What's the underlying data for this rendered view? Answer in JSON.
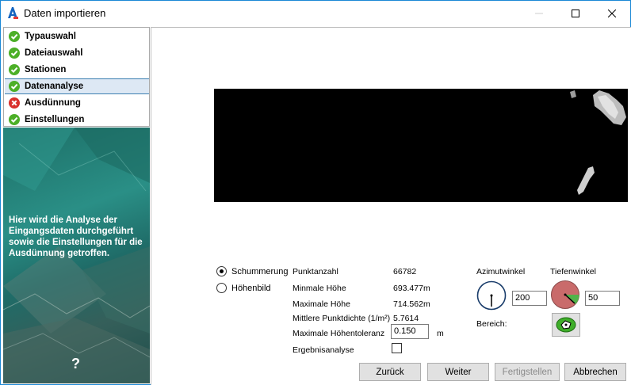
{
  "window": {
    "title": "Daten importieren"
  },
  "steps": [
    {
      "label": "Typauswahl",
      "status": "ok"
    },
    {
      "label": "Dateiauswahl",
      "status": "ok"
    },
    {
      "label": "Stationen",
      "status": "ok"
    },
    {
      "label": "Datenanalyse",
      "status": "ok"
    },
    {
      "label": "Ausdünnung",
      "status": "error"
    },
    {
      "label": "Einstellungen",
      "status": "ok"
    }
  ],
  "info_panel": {
    "text": "Hier wird die Analyse der Eingangsdaten durchgeführt sowie die Einstellungen für die Ausdünnung getroffen.",
    "help": "?"
  },
  "render_mode": {
    "options": [
      "Schummerung",
      "Höhenbild"
    ],
    "selected": "Schummerung"
  },
  "stats": [
    {
      "label": "Punktanzahl",
      "value": "66782"
    },
    {
      "label": "Minmale Höhe",
      "value": "693.477m"
    },
    {
      "label": "Maximale Höhe",
      "value": "714.562m"
    },
    {
      "label": "Mittlere Punktdichte (1/m²)",
      "value": "5.7614"
    }
  ],
  "tolerance": {
    "label": "Maximale Höhentoleranz",
    "value": "0.150",
    "unit": "m"
  },
  "result_analysis": {
    "label": "Ergebnisanalyse",
    "checked": false
  },
  "azimuth": {
    "label": "Azimutwinkel",
    "value": "200"
  },
  "depth": {
    "label": "Tiefenwinkel",
    "value": "50"
  },
  "bereich": {
    "label": "Bereich:"
  },
  "buttons": {
    "back": "Zurück",
    "next": "Weiter",
    "finish": "Fertigstellen",
    "cancel": "Abbrechen"
  },
  "colors": {
    "accent": "#1b88d6",
    "ok": "#4caf27",
    "error": "#d9302c",
    "panel": "#2a8f86"
  }
}
